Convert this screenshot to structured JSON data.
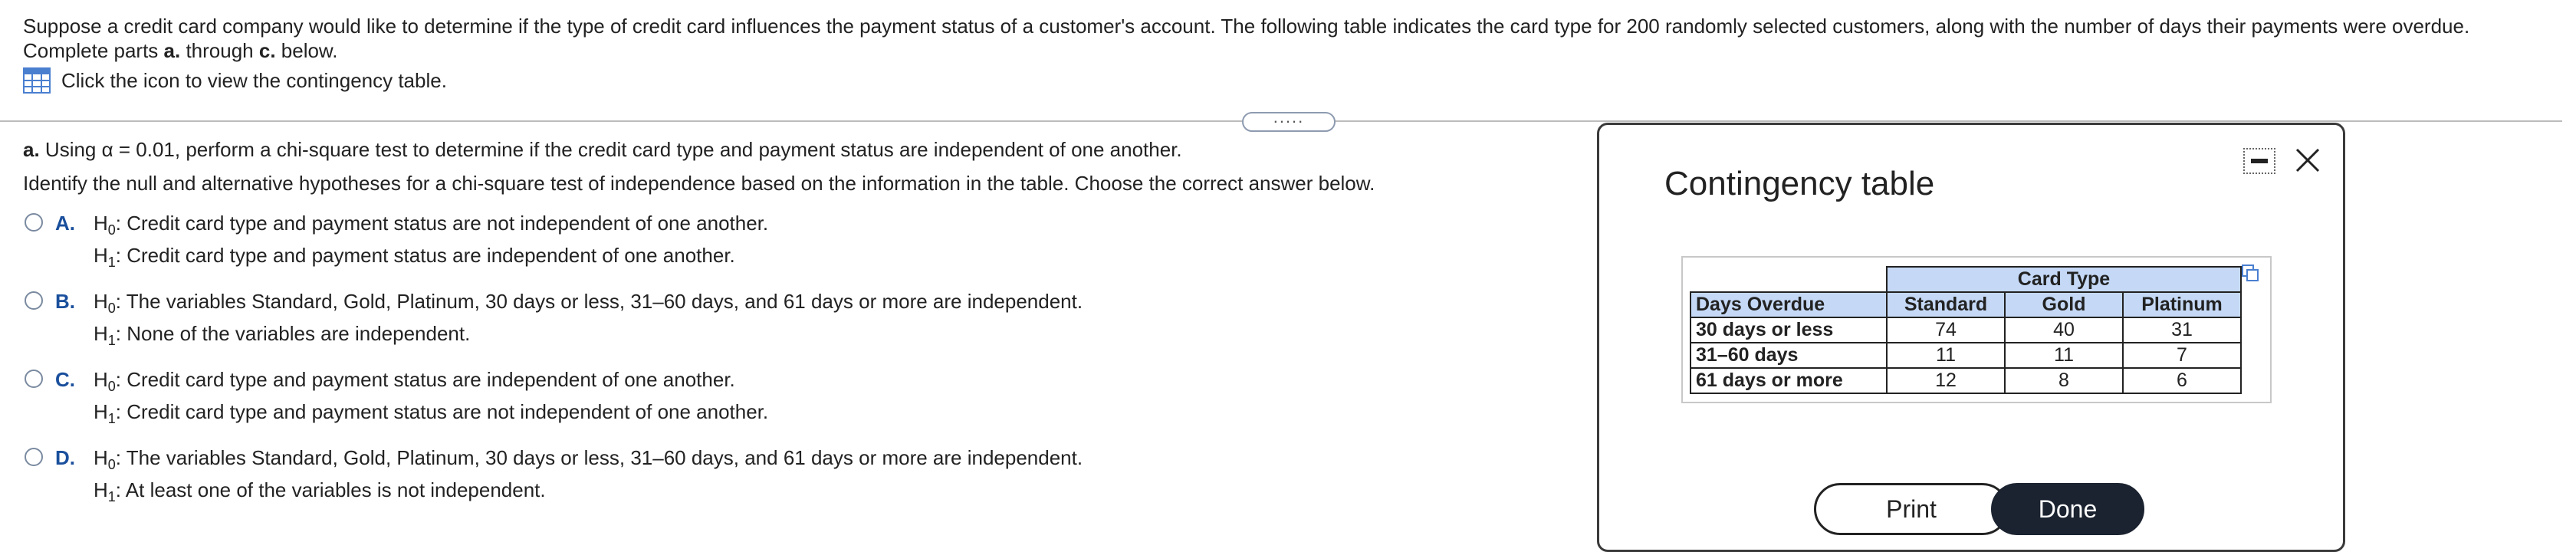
{
  "intro": {
    "text_part1": "Suppose a credit card company would like to determine if the type of credit card influences the payment status of a customer's account. The following table indicates the card type for 200 randomly selected customers, along with the number of days their payments were overdue.",
    "text_part2_prefix": "Complete parts ",
    "a": "a.",
    "through": " through ",
    "c": "c.",
    "below": " below.",
    "table_link": "Click the icon to view the contingency table."
  },
  "divider_handle": ".....",
  "part_a": {
    "label": "a.",
    "text": " Using α = 0.01, perform a chi-square test to determine if the credit card type and payment  status are independent of one another.",
    "instruction": "Identify the null and alternative hypotheses for a chi-square test of independence based on the information in the table. Choose the correct answer below."
  },
  "options": [
    {
      "letter": "A.",
      "h0": ": Credit card type and payment status are not independent of one another.",
      "h1": ": Credit card type and payment status are independent of one another."
    },
    {
      "letter": "B.",
      "h0": ": The variables Standard, Gold, Platinum, 30 days or less, 31–60 days, and 61 days  or more are independent.",
      "h1": ": None of the variables are independent."
    },
    {
      "letter": "C.",
      "h0": ": Credit card type and payment status are independent of one another.",
      "h1": ": Credit card type and payment status are not independent of one another."
    },
    {
      "letter": "D.",
      "h0": ": The variables Standard, Gold, Platinum, 30 days or less, 31–60 days, and 61 days  or more are independent.",
      "h1": ": At least one of the variables is not independent."
    }
  ],
  "h_sym": "H",
  "h0_sub": "0",
  "h1_sub": "1",
  "modal": {
    "title": "Contingency table",
    "table": {
      "group_header": "Card Type",
      "row_header": "Days Overdue",
      "columns": [
        "Standard",
        "Gold",
        "Platinum"
      ],
      "rows": [
        {
          "label": "30 days or less",
          "values": [
            "74",
            "40",
            "31"
          ]
        },
        {
          "label": "31–60 days",
          "values": [
            "11",
            "11",
            "7"
          ]
        },
        {
          "label": "61 days or more",
          "values": [
            "12",
            "8",
            "6"
          ]
        }
      ]
    },
    "print_label": "Print",
    "done_label": "Done"
  },
  "colors": {
    "header_blue": "#c5d9f6",
    "done_bg": "#1b2330",
    "option_letter": "#1a4f9c"
  }
}
